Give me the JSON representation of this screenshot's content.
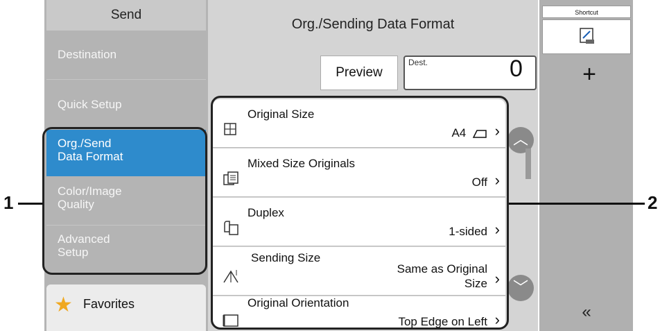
{
  "left_menu": {
    "header": "Send",
    "items": [
      {
        "label": "Destination"
      },
      {
        "label": "Quick Setup"
      },
      {
        "label": "Org./Send\nData Format",
        "line1": "Org./Send",
        "line2": "Data Format",
        "selected": true
      },
      {
        "label": "Color/Image Quality",
        "line1": "Color/Image",
        "line2": "Quality"
      },
      {
        "label": "Advanced Setup",
        "line1": "Advanced",
        "line2": "Setup"
      }
    ],
    "favorites": {
      "label": "Favorites",
      "icon": "star-icon"
    }
  },
  "main": {
    "title": "Org./Sending Data Format",
    "preview_label": "Preview",
    "dest_label": "Dest.",
    "dest_count": "0",
    "rows": [
      {
        "label": "Original Size",
        "value": "A4",
        "value_icon": "portrait-orientation-icon",
        "icon": "original-size-icon"
      },
      {
        "label": "Mixed Size Originals",
        "value": "Off",
        "icon": "mixed-size-icon"
      },
      {
        "label": "Duplex",
        "value": "1-sided",
        "icon": "duplex-icon"
      },
      {
        "label": "Sending Size",
        "value_line1": "Same as Original",
        "value_line2": "Size",
        "icon": "sending-size-icon"
      },
      {
        "label": "Original Orientation",
        "value": "Top Edge on Left",
        "icon": "orientation-icon"
      }
    ]
  },
  "right_panel": {
    "shortcut_label": "Shortcut",
    "add_label": "+",
    "collapse_label": "«"
  },
  "callouts": {
    "one": "1",
    "two": "2"
  },
  "colors": {
    "accent": "#2e8bcc",
    "panel": "#b4b4b4",
    "main": "#d4d4d4"
  }
}
